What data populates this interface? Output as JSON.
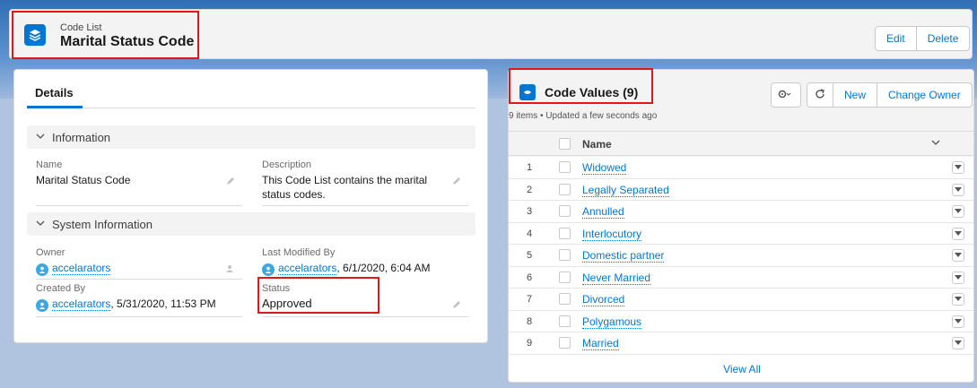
{
  "header": {
    "object_type": "Code List",
    "record_name": "Marital Status Code",
    "actions": [
      "Edit",
      "Delete"
    ]
  },
  "details": {
    "tab_label": "Details",
    "sections": {
      "information": "Information",
      "system": "System Information"
    },
    "fields": {
      "name_label": "Name",
      "name_value": "Marital Status Code",
      "description_label": "Description",
      "description_value": "This Code List contains the marital status codes.",
      "owner_label": "Owner",
      "owner_value": "accelarators",
      "last_modified_label": "Last Modified By",
      "last_modified_user": "accelarators",
      "last_modified_time": ", 6/1/2020, 6:04 AM",
      "created_label": "Created By",
      "created_user": "accelarators",
      "created_time": ", 5/31/2020, 11:53 PM",
      "status_label": "Status",
      "status_value": "Approved"
    }
  },
  "code_values": {
    "title": "Code Values (9)",
    "subtitle": "9 items • Updated a few seconds ago",
    "actions": [
      "New",
      "Change Owner"
    ],
    "column_name": "Name",
    "rows": [
      {
        "num": "1",
        "name": "Widowed"
      },
      {
        "num": "2",
        "name": "Legally Separated"
      },
      {
        "num": "3",
        "name": "Annulled"
      },
      {
        "num": "4",
        "name": "Interlocutory"
      },
      {
        "num": "5",
        "name": "Domestic partner"
      },
      {
        "num": "6",
        "name": "Never Married"
      },
      {
        "num": "7",
        "name": "Divorced"
      },
      {
        "num": "8",
        "name": "Polygamous"
      },
      {
        "num": "9",
        "name": "Married"
      }
    ],
    "view_all": "View All"
  },
  "colors": {
    "brand": "#0176d3",
    "highlight": "#e0161b"
  },
  "icons": [
    "stack-icon",
    "pencil-icon",
    "chevron-down-icon",
    "gear-icon",
    "refresh-icon",
    "avatar-icon",
    "code-value-icon"
  ]
}
